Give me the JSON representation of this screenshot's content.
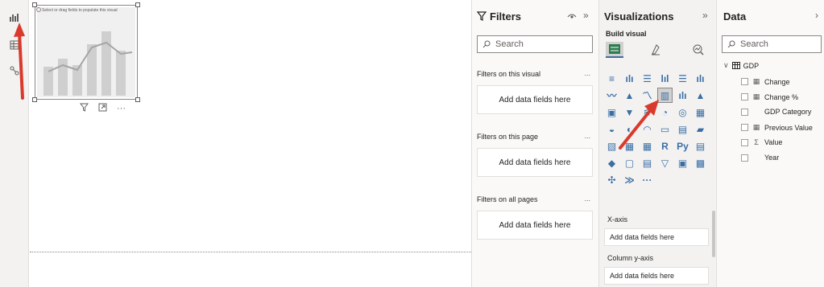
{
  "canvas": {
    "visual_hint": "Select or drag fields to populate this visual",
    "more_label": "···"
  },
  "filters": {
    "title": "Filters",
    "search_placeholder": "Search",
    "sections": [
      {
        "label": "Filters on this visual",
        "dots": "...",
        "well": "Add data fields here"
      },
      {
        "label": "Filters on this page",
        "dots": "...",
        "well": "Add data fields here"
      },
      {
        "label": "Filters on all pages",
        "dots": "...",
        "well": "Add data fields here"
      }
    ]
  },
  "visualizations": {
    "title": "Visualizations",
    "subtitle": "Build visual",
    "gallery": [
      [
        "≡",
        "ılı",
        "☰",
        "lıl",
        "☰",
        "ılı"
      ],
      [
        "〰",
        "▲",
        "〽",
        "▥",
        "ılı",
        "▲"
      ],
      [
        "▣",
        "▼",
        "⚟",
        "◔",
        "◎",
        "▦"
      ],
      [
        "◒",
        "◐",
        "◠",
        "▭",
        "▤",
        "▰"
      ],
      [
        "▧",
        "▦",
        "▦",
        "R",
        "Py",
        "▤"
      ],
      [
        "◆",
        "▢",
        "▤",
        "▽",
        "▣",
        "▩"
      ],
      [
        "✣",
        "≫",
        "···",
        "",
        "",
        ""
      ]
    ],
    "wells": [
      {
        "label": "X-axis",
        "placeholder": "Add data fields here"
      },
      {
        "label": "Column y-axis",
        "placeholder": "Add data fields here"
      }
    ]
  },
  "data": {
    "title": "Data",
    "search_placeholder": "Search",
    "table_name": "GDP",
    "fields": [
      {
        "icon": "calc",
        "label": "Change"
      },
      {
        "icon": "calc",
        "label": "Change %"
      },
      {
        "icon": "",
        "label": "GDP Category"
      },
      {
        "icon": "calc",
        "label": "Previous Value"
      },
      {
        "icon": "sigma",
        "label": "Value"
      },
      {
        "icon": "",
        "label": "Year"
      }
    ]
  },
  "colors": {
    "accent_red": "#d93a2b",
    "selected_viz_bg": "#d2d0ce",
    "gallery_icon": "#3a6ea5"
  }
}
